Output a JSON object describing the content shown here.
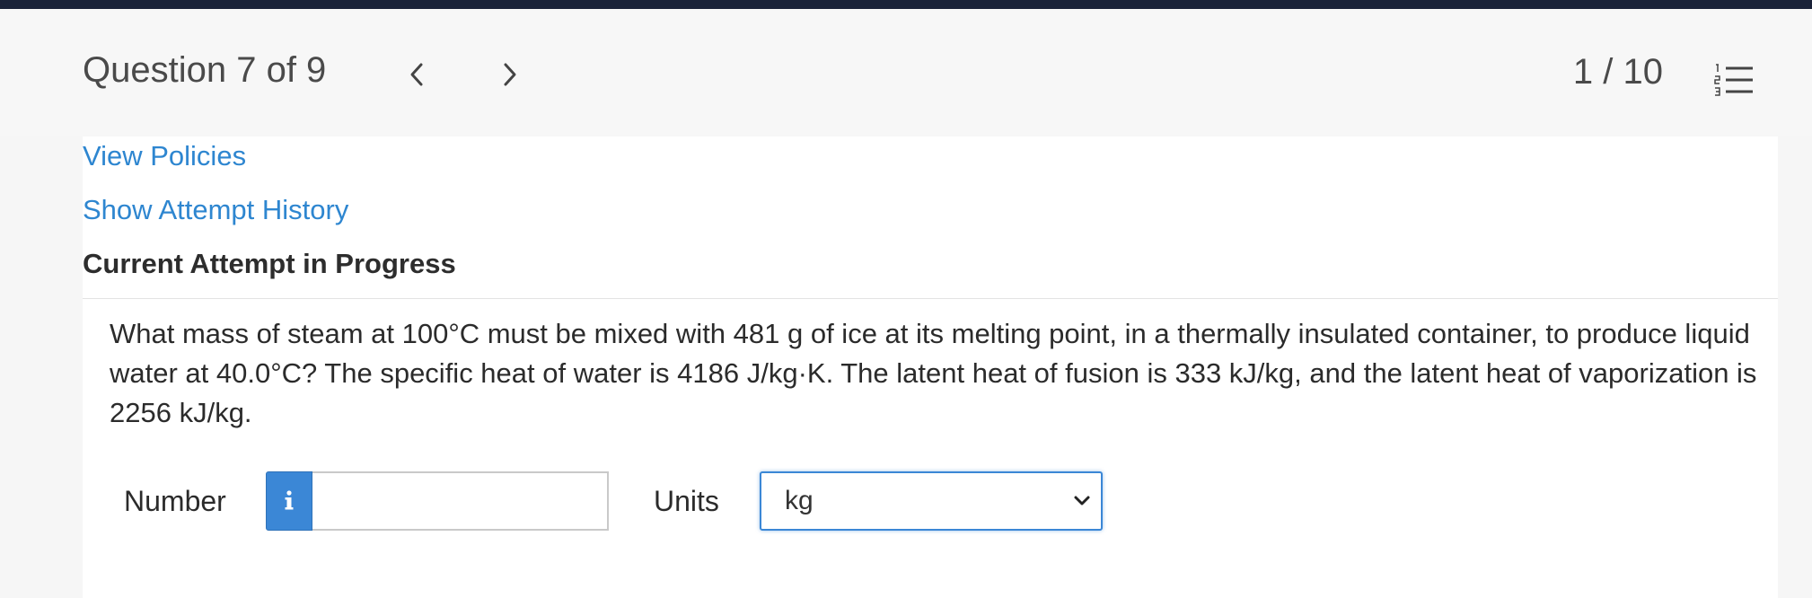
{
  "header": {
    "question_label": "Question 7 of 9",
    "prev_icon": "chevron-left-icon",
    "next_icon": "chevron-right-icon",
    "page_count": "1 / 10",
    "list_icon": "numbered-list-icon"
  },
  "links": {
    "view_policies": "View Policies",
    "show_attempt_history": "Show Attempt History"
  },
  "attempt": {
    "heading": "Current Attempt in Progress"
  },
  "question": {
    "text": "What mass of steam at 100°C must be mixed with 481 g of ice at its melting point, in a thermally insulated container, to produce liquid water at 40.0°C? The specific heat of water is 4186 J/kg·K. The latent heat of fusion is 333 kJ/kg, and the latent heat of vaporization is 2256 kJ/kg."
  },
  "answer": {
    "number_label": "Number",
    "number_value": "",
    "info_icon": "info-icon",
    "units_label": "Units",
    "units_selected": "kg"
  },
  "colors": {
    "top_bar": "#1a2238",
    "link": "#2e86d0",
    "accent": "#3b87d6"
  }
}
